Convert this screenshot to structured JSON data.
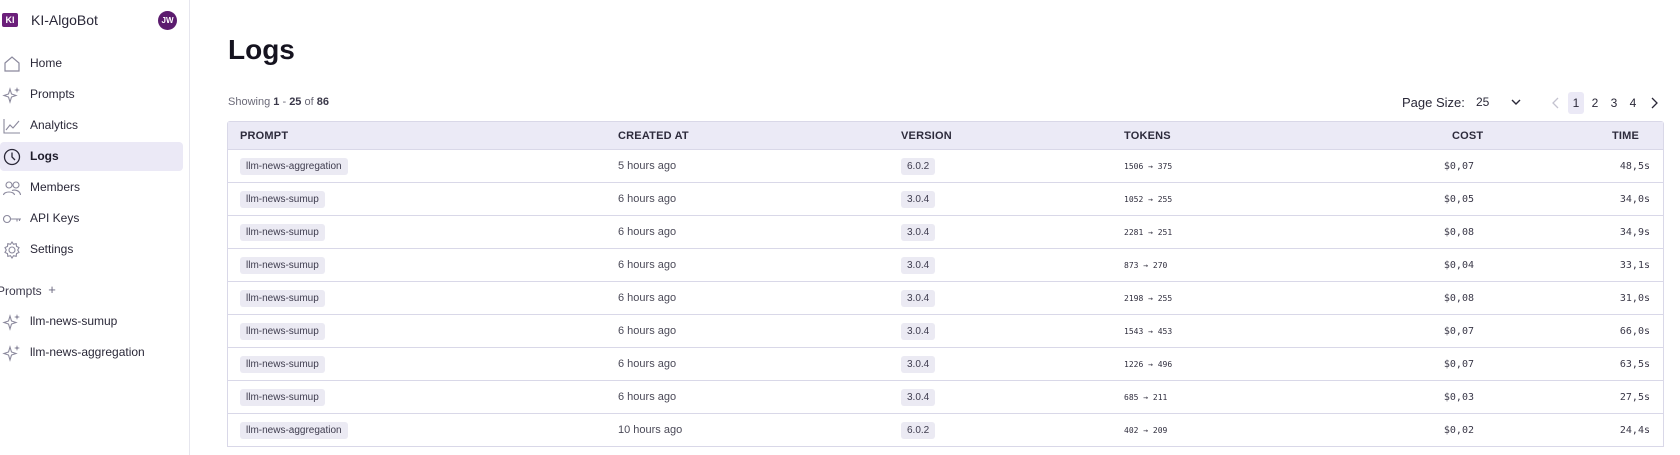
{
  "app": {
    "logo_text": "KI",
    "name": "KI-AlgoBot",
    "avatar_initials": "JW"
  },
  "sidebar": {
    "items": [
      {
        "label": "Home",
        "icon": "home-icon",
        "active": false
      },
      {
        "label": "Prompts",
        "icon": "sparkles-icon",
        "active": false
      },
      {
        "label": "Analytics",
        "icon": "chart-line-icon",
        "active": false
      },
      {
        "label": "Logs",
        "icon": "clock-icon",
        "active": true
      },
      {
        "label": "Members",
        "icon": "users-icon",
        "active": false
      },
      {
        "label": "API Keys",
        "icon": "key-icon",
        "active": false
      },
      {
        "label": "Settings",
        "icon": "gear-icon",
        "active": false
      }
    ],
    "prompts_section": {
      "title": "Prompts",
      "add_symbol": "+",
      "items": [
        {
          "label": "llm-news-sumup",
          "icon": "sparkles-icon"
        },
        {
          "label": "llm-news-aggregation",
          "icon": "sparkles-icon"
        }
      ]
    }
  },
  "main": {
    "title": "Logs",
    "showing": {
      "prefix": "Showing",
      "from": "1",
      "separator": "-",
      "to": "25",
      "of_label": "of",
      "total": "86"
    },
    "page_size": {
      "label": "Page Size:",
      "value": "25"
    },
    "pagination": {
      "pages": [
        "1",
        "2",
        "3",
        "4"
      ],
      "current": "1"
    },
    "table": {
      "columns": [
        "PROMPT",
        "CREATED AT",
        "VERSION",
        "TOKENS",
        "COST",
        "TIME"
      ],
      "rows": [
        {
          "prompt": "llm-news-aggregation",
          "created": "5 hours ago",
          "version": "6.0.2",
          "tokens": "1506 → 375",
          "cost": "$0,07",
          "time": "48,5s"
        },
        {
          "prompt": "llm-news-sumup",
          "created": "6 hours ago",
          "version": "3.0.4",
          "tokens": "1052 → 255",
          "cost": "$0,05",
          "time": "34,0s"
        },
        {
          "prompt": "llm-news-sumup",
          "created": "6 hours ago",
          "version": "3.0.4",
          "tokens": "2281 → 251",
          "cost": "$0,08",
          "time": "34,9s"
        },
        {
          "prompt": "llm-news-sumup",
          "created": "6 hours ago",
          "version": "3.0.4",
          "tokens": "873 → 270",
          "cost": "$0,04",
          "time": "33,1s"
        },
        {
          "prompt": "llm-news-sumup",
          "created": "6 hours ago",
          "version": "3.0.4",
          "tokens": "2198 → 255",
          "cost": "$0,08",
          "time": "31,0s"
        },
        {
          "prompt": "llm-news-sumup",
          "created": "6 hours ago",
          "version": "3.0.4",
          "tokens": "1543 → 453",
          "cost": "$0,07",
          "time": "66,0s"
        },
        {
          "prompt": "llm-news-sumup",
          "created": "6 hours ago",
          "version": "3.0.4",
          "tokens": "1226 → 496",
          "cost": "$0,07",
          "time": "63,5s"
        },
        {
          "prompt": "llm-news-sumup",
          "created": "6 hours ago",
          "version": "3.0.4",
          "tokens": "685 → 211",
          "cost": "$0,03",
          "time": "27,5s"
        },
        {
          "prompt": "llm-news-aggregation",
          "created": "10 hours ago",
          "version": "6.0.2",
          "tokens": "402 → 209",
          "cost": "$0,02",
          "time": "24,4s"
        }
      ]
    }
  },
  "colors": {
    "brand": "#6b1f7a",
    "avatar": "#5b1b6e",
    "active_bg": "#ebe9f6",
    "header_bg": "#ebeaf6",
    "border": "#d9d8e8"
  }
}
